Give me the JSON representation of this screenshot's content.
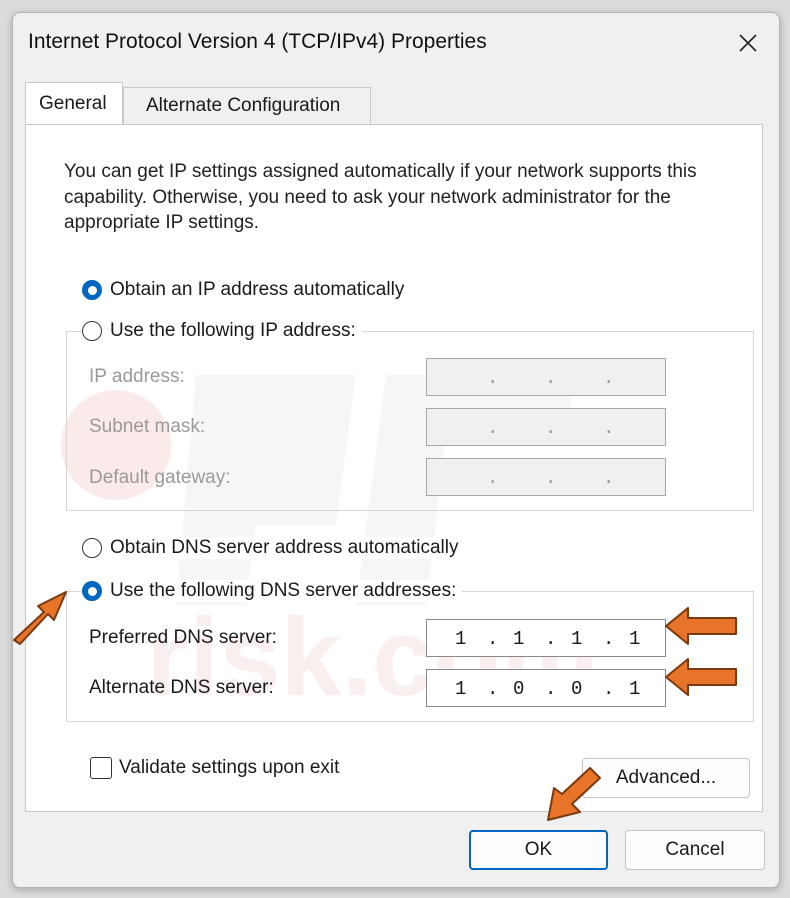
{
  "window": {
    "title": "Internet Protocol Version 4 (TCP/IPv4) Properties",
    "close_glyph": "✕"
  },
  "tabs": [
    {
      "label": "General",
      "active": true
    },
    {
      "label": "Alternate Configuration",
      "active": false
    }
  ],
  "general": {
    "intro_text": "You can get IP settings assigned automatically if your network supports this capability. Otherwise, you need to ask your network administrator for the appropriate IP settings.",
    "ip_options": {
      "auto_label": "Obtain an IP address automatically",
      "auto_selected": true,
      "manual_label": "Use the following IP address:",
      "manual_selected": false
    },
    "ip_fields": [
      {
        "label": "IP address:",
        "value": ". . .",
        "enabled": false
      },
      {
        "label": "Subnet mask:",
        "value": ". . .",
        "enabled": false
      },
      {
        "label": "Default gateway:",
        "value": ". . .",
        "enabled": false
      }
    ],
    "dns_options": {
      "auto_label": "Obtain DNS server address automatically",
      "auto_selected": false,
      "manual_label": "Use the following DNS server addresses:",
      "manual_selected": true
    },
    "dns_fields": [
      {
        "label": "Preferred DNS server:",
        "octets": [
          "1",
          "1",
          "1",
          "1"
        ],
        "enabled": true
      },
      {
        "label": "Alternate DNS server:",
        "octets": [
          "1",
          "0",
          "0",
          "1"
        ],
        "enabled": true
      }
    ],
    "validate_label": "Validate settings upon exit",
    "validate_checked": false,
    "advanced_label": "Advanced..."
  },
  "footer": {
    "ok_label": "OK",
    "cancel_label": "Cancel"
  },
  "watermark": {
    "text": "risk.com"
  },
  "colors": {
    "accent": "#0067c0",
    "arrow": "#e8742a"
  },
  "icons": {
    "close": "close-icon",
    "annotation_arrow": "arrow-icon"
  }
}
